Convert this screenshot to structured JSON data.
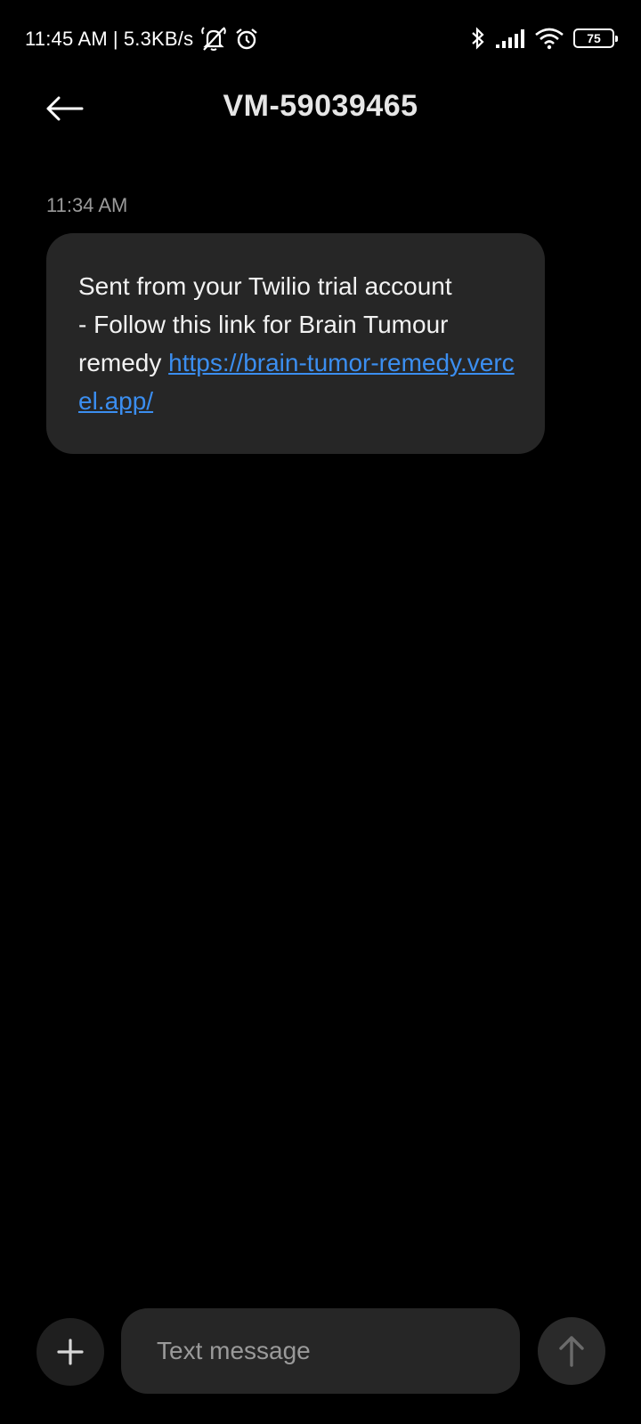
{
  "status_bar": {
    "time": "11:45 AM",
    "separator": "|",
    "network_speed": "5.3KB/s",
    "icons": [
      "notifications-muted-icon",
      "alarm-icon",
      "bluetooth-icon",
      "signal-icon",
      "wifi-icon",
      "battery-icon"
    ],
    "battery_level": "75"
  },
  "header": {
    "back_icon": "arrow-left-icon",
    "title": "VM-59039465"
  },
  "conversation": {
    "messages": [
      {
        "timestamp": "11:34 AM",
        "text_line1": "Sent from your Twilio trial account",
        "text_line2": "- Follow this link for Brain Tumour",
        "text_line3_prefix": "remedy ",
        "link": "https://brain-tumor-remedy.vercel.app/"
      }
    ]
  },
  "composer": {
    "add_icon": "plus-icon",
    "placeholder": "Text message",
    "value": "",
    "send_icon": "arrow-up-icon"
  },
  "colors": {
    "background": "#000000",
    "bubble": "#262626",
    "link": "#3b8ef0",
    "muted_text": "#9a9a9a"
  }
}
